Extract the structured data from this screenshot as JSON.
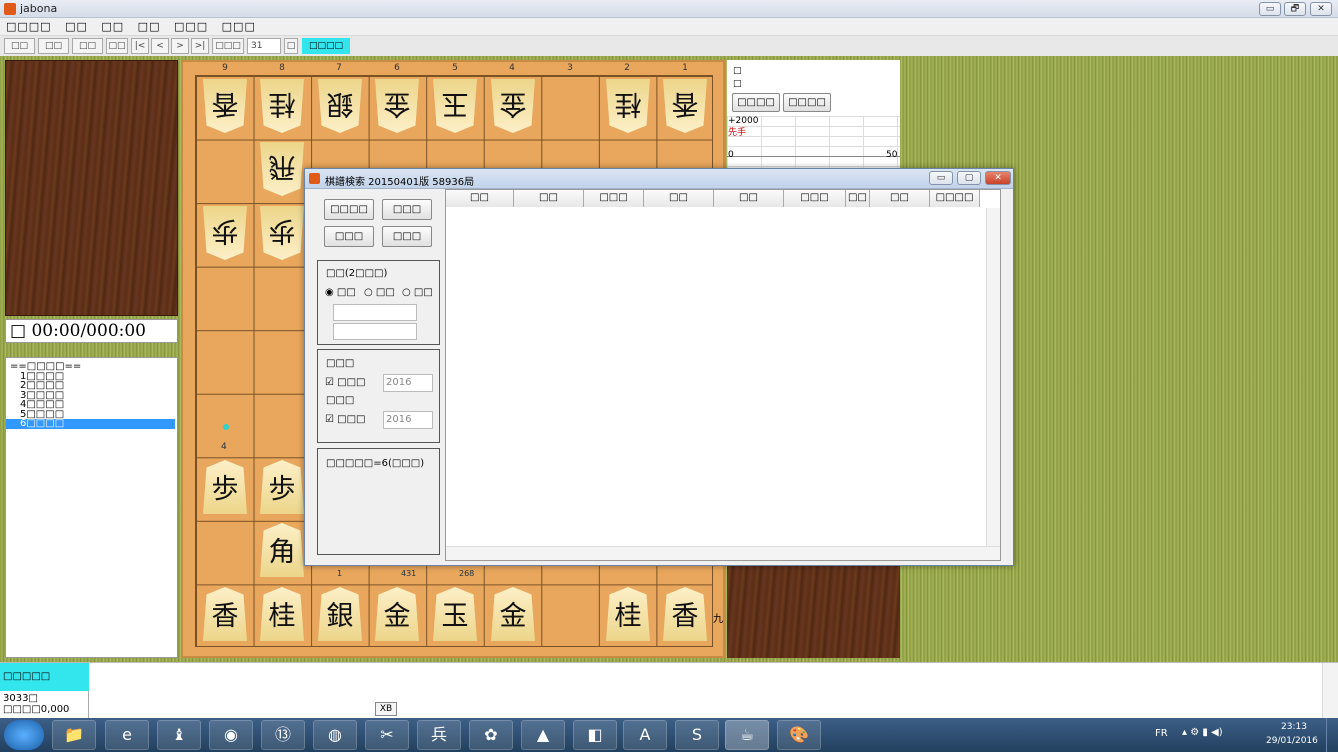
{
  "window": {
    "title": "jabona",
    "controls": [
      "▭",
      "🗗",
      "✕"
    ]
  },
  "menu": [
    "□□□□",
    "□□",
    "□□",
    "□□",
    "□□□",
    "□□□"
  ],
  "toolbar": {
    "buttons": [
      "□□",
      "□□",
      "□□",
      "□□",
      "|<",
      "<",
      ">",
      ">|",
      "□□□"
    ],
    "move_input": "31",
    "small_btn": "□",
    "cyan_button": "□□□□"
  },
  "board": {
    "col_labels": [
      "9",
      "8",
      "7",
      "6",
      "5",
      "4",
      "3",
      "2",
      "1"
    ],
    "row_label_9": "九",
    "top_row": [
      "香",
      "桂",
      "銀",
      "金",
      "玉",
      "金",
      "",
      "桂",
      "香"
    ],
    "row2": [
      "",
      "飛",
      "",
      "",
      "",
      "",
      "",
      "",
      ""
    ],
    "pawns_top": [
      "歩",
      "歩"
    ],
    "pawns_bottom": [
      "歩",
      "歩"
    ],
    "kaku": "角",
    "bottom_row": [
      "香",
      "桂",
      "銀",
      "金",
      "玉",
      "金",
      "",
      "桂",
      "香"
    ],
    "partial_marks": [
      "4",
      "1",
      "431",
      "268"
    ]
  },
  "clock": {
    "text": "□ 00:00/000:00"
  },
  "kifu_list": {
    "header": "==□□□□==",
    "items": [
      "1□□□□",
      "2□□□□",
      "3□□□□",
      "4□□□□",
      "5□□□□",
      "6□□□□"
    ],
    "selected_index": 5
  },
  "info_panel": {
    "check1": "□",
    "check2": "□",
    "button1": "□□□□",
    "button2": "□□□□",
    "graph_top": "+2000",
    "graph_player": "先手",
    "graph_zero": "0",
    "graph_fifty": "50"
  },
  "dialog": {
    "title": "棋譜検索 20150401版 58936局",
    "buttons": [
      "□□□□",
      "□□□",
      "□□□",
      "□□□"
    ],
    "group1_title": "□□(2□□□)",
    "radios": [
      "□□",
      "□□",
      "□□"
    ],
    "group2_title": "□□□",
    "from_label": "□□□",
    "from_year": "2016",
    "to_title": "□□□",
    "to_label": "□□□",
    "to_year": "2016",
    "result_text": "□□□□□=6(□□□)",
    "columns": [
      "□□",
      "□□",
      "□□□",
      "□□",
      "□□",
      "□□□",
      "□□",
      "□□",
      "□□□□"
    ]
  },
  "status": {
    "cyan_label": "□□□□□",
    "line1": "3033□",
    "line2": "□□□□0,000"
  },
  "taskbar": {
    "tooltip": "XB",
    "lang": "FR",
    "time": "23:13",
    "date": "29/01/2016"
  }
}
